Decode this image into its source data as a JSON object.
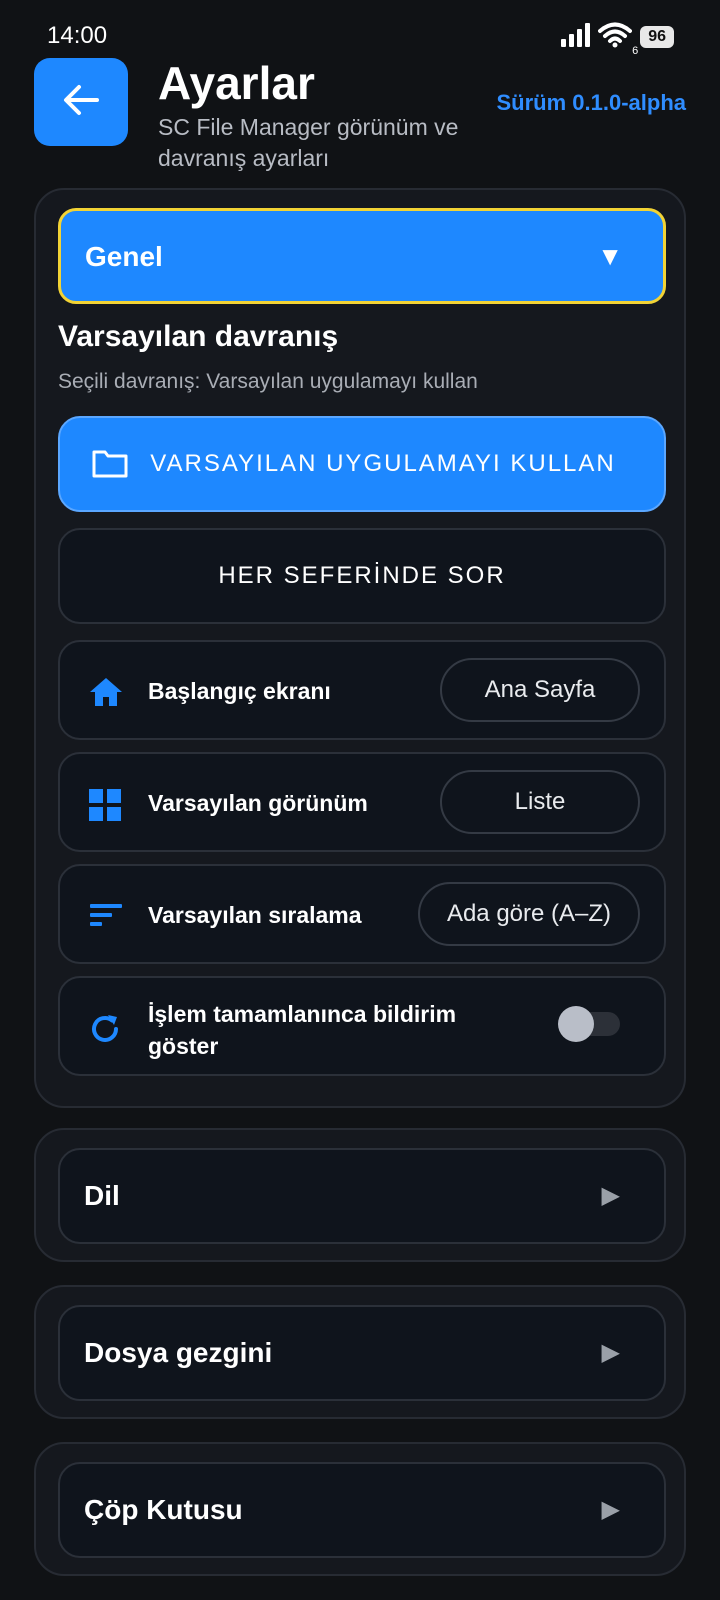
{
  "status_bar": {
    "time": "14:00",
    "battery": "96",
    "wifi_sub": "6"
  },
  "header": {
    "title": "Ayarlar",
    "subtitle": "SC File Manager görünüm ve davranış ayarları",
    "version": "Sürüm 0.1.0-alpha"
  },
  "genel": {
    "label": "Genel",
    "arrow": "▼",
    "section_title": "Varsayılan davranış",
    "section_subtitle": "Seçili davranış: Varsayılan uygulamayı kullan",
    "btn_default_app": "VARSAYILAN UYGULAMAYI KULLAN",
    "btn_ask": "HER SEFERİNDE SOR",
    "rows": [
      {
        "label": "Başlangıç ekranı",
        "value": "Ana Sayfa",
        "icon": "home-icon"
      },
      {
        "label": "Varsayılan görünüm",
        "value": "Liste",
        "icon": "grid-icon"
      },
      {
        "label": "Varsayılan sıralama",
        "value": "Ada göre (A–Z)",
        "icon": "sort-icon"
      },
      {
        "label": "İşlem tamamlanınca bildirim göster",
        "icon": "refresh-icon",
        "toggle_on": false
      }
    ]
  },
  "sections": [
    {
      "label": "Dil",
      "arrow": "▶"
    },
    {
      "label": "Dosya gezgini",
      "arrow": "▶"
    },
    {
      "label": "Çöp Kutusu",
      "arrow": "▶"
    }
  ],
  "colors": {
    "accent": "#1e88ff",
    "focus": "#f2d335",
    "background": "#101215"
  }
}
